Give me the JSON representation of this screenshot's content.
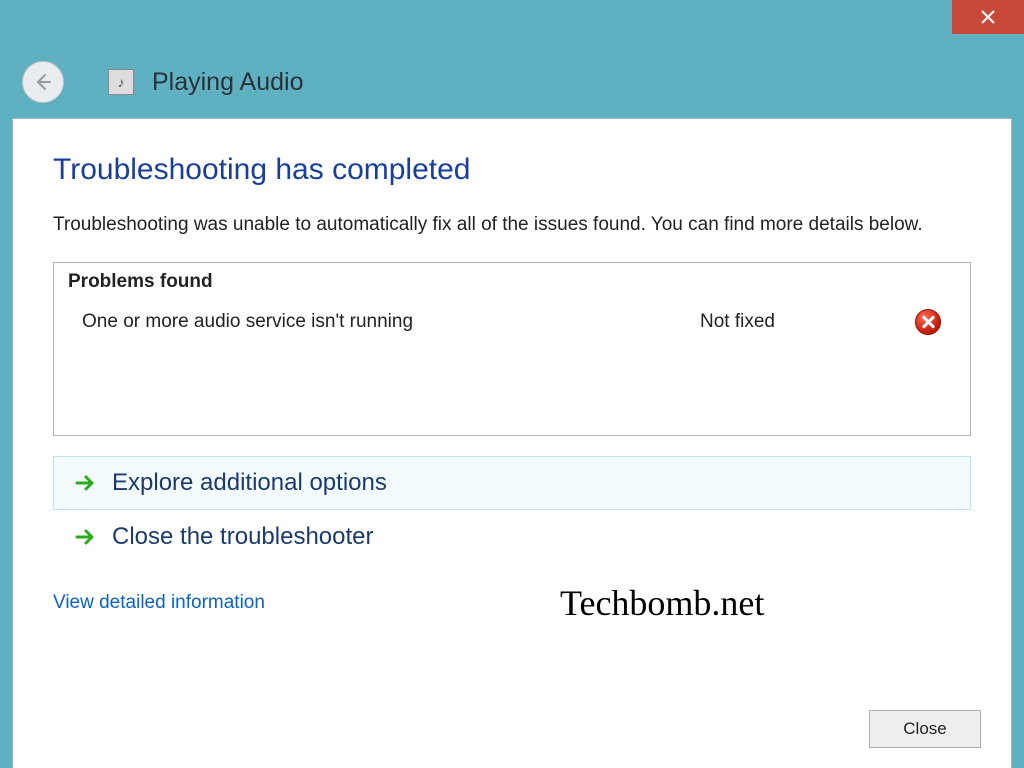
{
  "window": {
    "title": "Playing Audio",
    "close_x_icon": "close-icon"
  },
  "main": {
    "heading": "Troubleshooting has completed",
    "subtext": "Troubleshooting was unable to automatically fix all of the issues found. You can find more details below.",
    "problems_header": "Problems found",
    "problems": [
      {
        "description": "One or more audio service isn't running",
        "status": "Not fixed",
        "icon": "error-icon"
      }
    ],
    "options": [
      {
        "label": "Explore additional options",
        "selected": true
      },
      {
        "label": "Close the troubleshooter",
        "selected": false
      }
    ],
    "detail_link": "View detailed information",
    "close_button": "Close"
  },
  "watermark": "Techbomb.net"
}
